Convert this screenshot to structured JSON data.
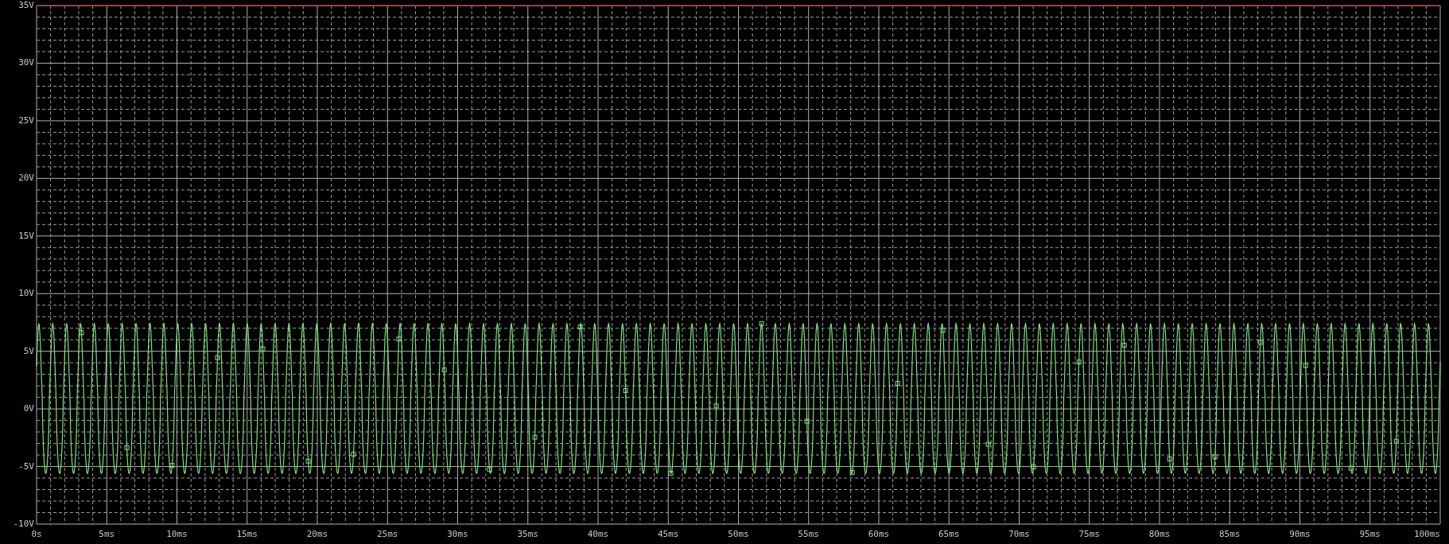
{
  "plot": {
    "y_axis_labels": [
      "35V",
      "30V",
      "25V",
      "20V",
      "15V",
      "10V",
      "5V",
      "0V",
      "-5V",
      "-10V"
    ],
    "x_axis_labels": [
      "0s",
      "5ms",
      "10ms",
      "15ms",
      "20ms",
      "25ms",
      "30ms",
      "35ms",
      "40ms",
      "45ms",
      "50ms",
      "55ms",
      "60ms",
      "65ms",
      "70ms",
      "75ms",
      "80ms",
      "85ms",
      "90ms",
      "95ms",
      "100ms"
    ]
  }
}
